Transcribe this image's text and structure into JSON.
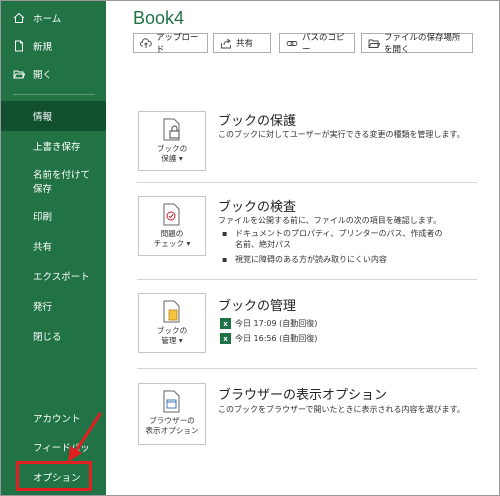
{
  "sidebar": {
    "home": "ホーム",
    "new": "新規",
    "open": "開く",
    "items": [
      {
        "label": "情報"
      },
      {
        "label": "上書き保存"
      },
      {
        "label": "名前を付けて保存"
      },
      {
        "label": "印刷"
      },
      {
        "label": "共有"
      },
      {
        "label": "エクスポート"
      },
      {
        "label": "発行"
      },
      {
        "label": "閉じる"
      }
    ],
    "account": "アカウント",
    "feedback": "フィードバック",
    "options": "オプション"
  },
  "main": {
    "title": "Book4",
    "toolbar": {
      "upload": "アップロード",
      "share": "共有",
      "copy_path": "パスのコピー",
      "open_location": "ファイルの保存場所を開く"
    },
    "protect": {
      "card_line1": "ブックの",
      "card_line2": "保護",
      "title": "ブックの保護",
      "desc": "このブックに対してユーザーが実行できる変更の種類を管理します。"
    },
    "inspect": {
      "card_line1": "問題の",
      "card_line2": "チェック",
      "title": "ブックの検査",
      "desc": "ファイルを公開する前に、ファイルの次の項目を確認します。",
      "bullets": [
        "ドキュメントのプロパティ、プリンターのパス、作成者の名前、絶対パス",
        "視覚に障碍のある方が読み取りにくい内容"
      ]
    },
    "manage": {
      "card_line1": "ブックの",
      "card_line2": "管理",
      "title": "ブックの管理",
      "versions": [
        "今日 17:09 (自動回復)",
        "今日 16:56 (自動回復)"
      ]
    },
    "browser": {
      "card_line1": "ブラウザーの",
      "card_line2": "表示オプション",
      "title": "ブラウザーの表示オプション",
      "desc": "このブックをブラウザーで開いたときに表示される内容を選びます。"
    }
  },
  "colors": {
    "sidebar": "#217346",
    "sidebar_active": "#10502f",
    "highlight": "#e02020"
  }
}
